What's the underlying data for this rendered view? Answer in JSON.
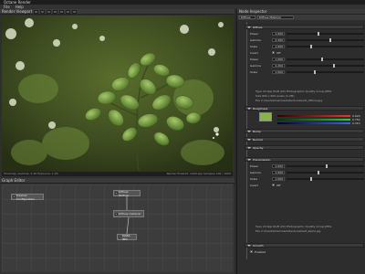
{
  "window": {
    "title": "Octane Render"
  },
  "menu": [
    "File",
    "Help"
  ],
  "render_viewport": {
    "header": "Render Viewport",
    "status_left": "Tonemap: Gamma: 2.20  Exposure: 1.00",
    "status_right": "Render finished: 1000 spp  Samples 100 / 1000"
  },
  "graph_editor": {
    "header": "Graph Editor",
    "nodes": {
      "preview": "Preview Configuration",
      "diffuse": "Diffuse material",
      "img": "Diffuse Texture",
      "out": "RGBΔ IMG"
    }
  },
  "node_inspector": {
    "header": "Node Inspector",
    "selector": "Diffuse",
    "selector2": "Diffuse Material",
    "sections": [
      "Diffuse",
      "Roughness",
      "Bump",
      "Normal",
      "Opacity",
      "Transmission",
      "Smooth"
    ],
    "fields": [
      {
        "label": "Power",
        "value": "1.000"
      },
      {
        "label": "Gamma",
        "value": "2.200"
      },
      {
        "label": "Scale",
        "value": "1.000"
      },
      {
        "label": "Invert",
        "value": "Off"
      },
      {
        "label": "Power",
        "value": "1.000"
      },
      {
        "label": "Gamma",
        "value": "2.200"
      },
      {
        "label": "Scale",
        "value": "1.000"
      },
      {
        "label": "Power",
        "value": "1.000"
      },
      {
        "label": "Gamma",
        "value": "1.000"
      },
      {
        "label": "Scale",
        "value": "1.000"
      },
      {
        "label": "Invert",
        "value": "Off"
      }
    ],
    "type_line": "Type  24 bpp RGB (24) Photographic Quality Group JPEG",
    "size_line": "Size  800 x 600 pixels (1.2M)",
    "file_line": "File  C:\\Users\\Downloads\\textures\\leaf_diffuse.jpg",
    "type_line2": "Type  24 bpp RGB (24) Photographic Quality Group JPEG",
    "file_line2": "File  C:\\Users\\Downloads\\textures\\leaf_alpha.jpg",
    "smooth_value": "Enabled",
    "color_values": [
      "0.620",
      "0.750",
      "0.310"
    ]
  },
  "colors": {
    "accent": "#86b34a",
    "panel": "#2d2d2d",
    "header": "#3a3a3a"
  }
}
